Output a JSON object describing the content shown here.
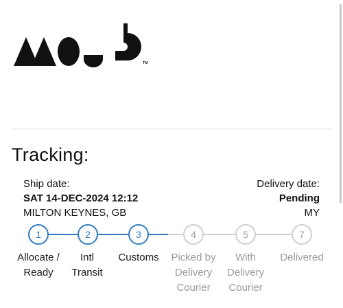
{
  "brand": {
    "logo_icon": "mous-logo",
    "logo_text": "MOUS",
    "trademark": "TM"
  },
  "tracking": {
    "heading": "Tracking:",
    "ship_label": "Ship date:",
    "ship_date": "SAT 14-DEC-2024 12:12",
    "origin": "MILTON KEYNES, GB",
    "delivery_label": "Delivery date:",
    "delivery_status": "Pending",
    "destination": "MY"
  },
  "steps": [
    {
      "number": "1",
      "label": "Allocate /\nReady",
      "status": "complete"
    },
    {
      "number": "2",
      "label": "Intl\nTransit",
      "status": "complete"
    },
    {
      "number": "3",
      "label": "Customs",
      "status": "complete"
    },
    {
      "number": "4",
      "label": "Picked by\nDelivery\nCourier",
      "status": "pending"
    },
    {
      "number": "5",
      "label": "With\nDelivery\nCourier",
      "status": "pending"
    },
    {
      "number": "7",
      "label": "Delivered",
      "status": "pending"
    }
  ],
  "colors": {
    "active": "#2f7cc0",
    "inactive": "#cfcfcf",
    "inactive_text": "#9a9a9a"
  }
}
